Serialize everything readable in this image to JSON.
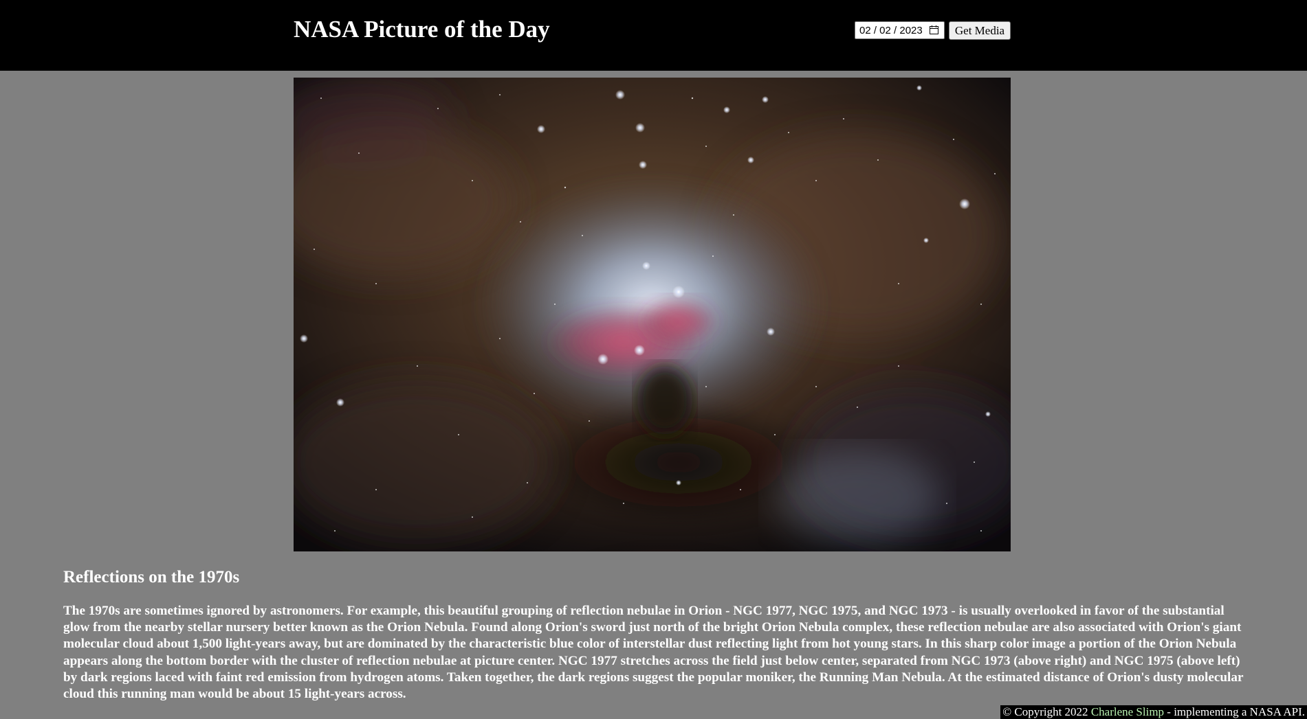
{
  "header": {
    "title": "NASA Picture of the Day",
    "date_value": "02 / 02 / 2023",
    "date_icon": "calendar-icon",
    "button_label": "Get Media"
  },
  "media": {
    "alt": "Reflection nebulae in Orion (Running Man Nebula)",
    "image_title": "Reflections on the 1970s",
    "explanation": "The 1970s are sometimes ignored by astronomers. For example, this beautiful grouping of reflection nebulae in Orion - NGC 1977, NGC 1975, and NGC 1973 - is usually overlooked in favor of the substantial glow from the nearby stellar nursery better known as the Orion Nebula. Found along Orion's sword just north of the bright Orion Nebula complex, these reflection nebulae are also associated with Orion's giant molecular cloud about 1,500 light-years away, but are dominated by the characteristic blue color of interstellar dust reflecting light from hot young stars. In this sharp color image a portion of the Orion Nebula appears along the bottom border with the cluster of reflection nebulae at picture center. NGC 1977 stretches across the field just below center, separated from NGC 1973 (above right) and NGC 1975 (above left) by dark regions laced with faint red emission from hydrogen atoms. Taken together, the dark regions suggest the popular moniker, the Running Man Nebula. At the estimated distance of Orion's dusty molecular cloud this running man would be about 15 light-years across."
  },
  "footer": {
    "prefix": "© Copyright 2022 ",
    "author": "Charlene Slimp",
    "suffix": " - implementing a NASA API."
  },
  "colors": {
    "page_bg": "#808080",
    "header_bg": "#000000",
    "text": "#ffffff",
    "author_link": "#b8f0b0"
  }
}
